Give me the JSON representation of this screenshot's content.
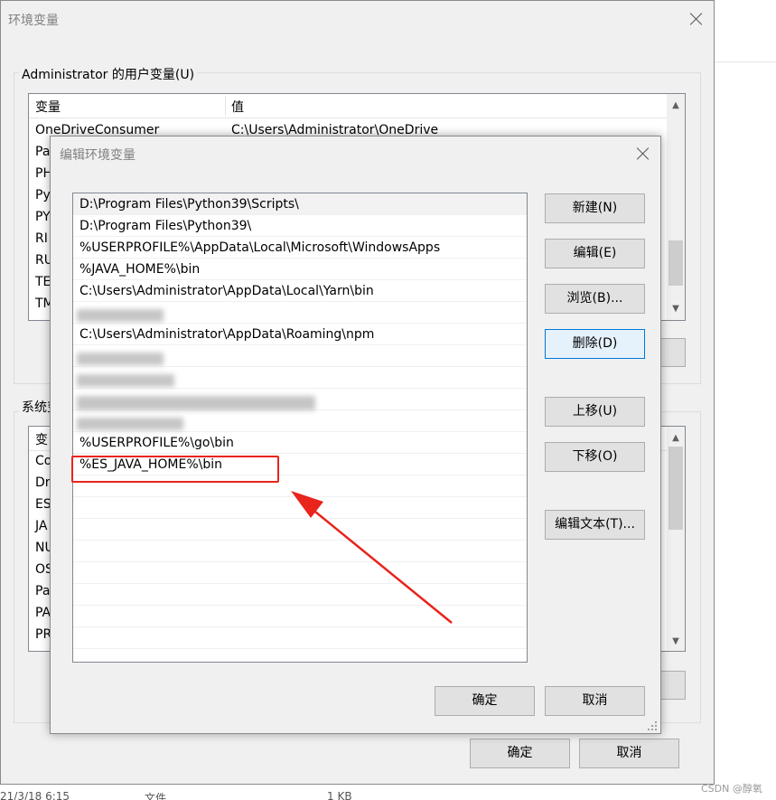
{
  "outer": {
    "title": "环境变量",
    "user_group_label": "Administrator 的用户变量(U)",
    "user_columns": {
      "variable": "变量",
      "value": "值"
    },
    "user_rows": [
      {
        "name": "OneDriveConsumer",
        "value": "C:\\Users\\Administrator\\OneDrive"
      },
      {
        "name": "Pa"
      },
      {
        "name": "PH"
      },
      {
        "name": "Py"
      },
      {
        "name": "PY"
      },
      {
        "name": "RI"
      },
      {
        "name": "RU"
      },
      {
        "name": "TE"
      },
      {
        "name": "TM"
      }
    ],
    "system_group_label": "系统变",
    "system_columns": {
      "variable": "变"
    },
    "system_rows": [
      "Co",
      "Dr",
      "ES",
      "JA",
      "NU",
      "OS",
      "Pa",
      "PA",
      "PR"
    ],
    "ok_label": "确定",
    "cancel_label": "取消"
  },
  "dialog": {
    "title": "编辑环境变量",
    "paths": [
      "D:\\Program Files\\Python39\\Scripts\\",
      "D:\\Program Files\\Python39\\",
      "%USERPROFILE%\\AppData\\Local\\Microsoft\\WindowsApps",
      "%JAVA_HOME%\\bin",
      "C:\\Users\\Administrator\\AppData\\Local\\Yarn\\bin",
      "",
      "C:\\Users\\Administrator\\AppData\\Roaming\\npm",
      "",
      "",
      "",
      "",
      "%USERPROFILE%\\go\\bin",
      "%ES_JAVA_HOME%\\bin",
      "",
      "",
      "",
      "",
      "",
      "",
      "",
      ""
    ],
    "buttons": {
      "new": "新建(N)",
      "edit": "编辑(E)",
      "browse": "浏览(B)...",
      "delete": "删除(D)",
      "move_up": "上移(U)",
      "move_down": "下移(O)",
      "edit_text": "编辑文本(T)...",
      "ok": "确定",
      "cancel": "取消"
    }
  },
  "background": {
    "file_row_date": "21/3/18 6:15",
    "file_row_type": "文件",
    "file_row_size": "1 KB"
  },
  "watermark": "CSDN @醇氧",
  "colors": {
    "highlight": "#e8241c",
    "focus_border": "#0078d7"
  }
}
